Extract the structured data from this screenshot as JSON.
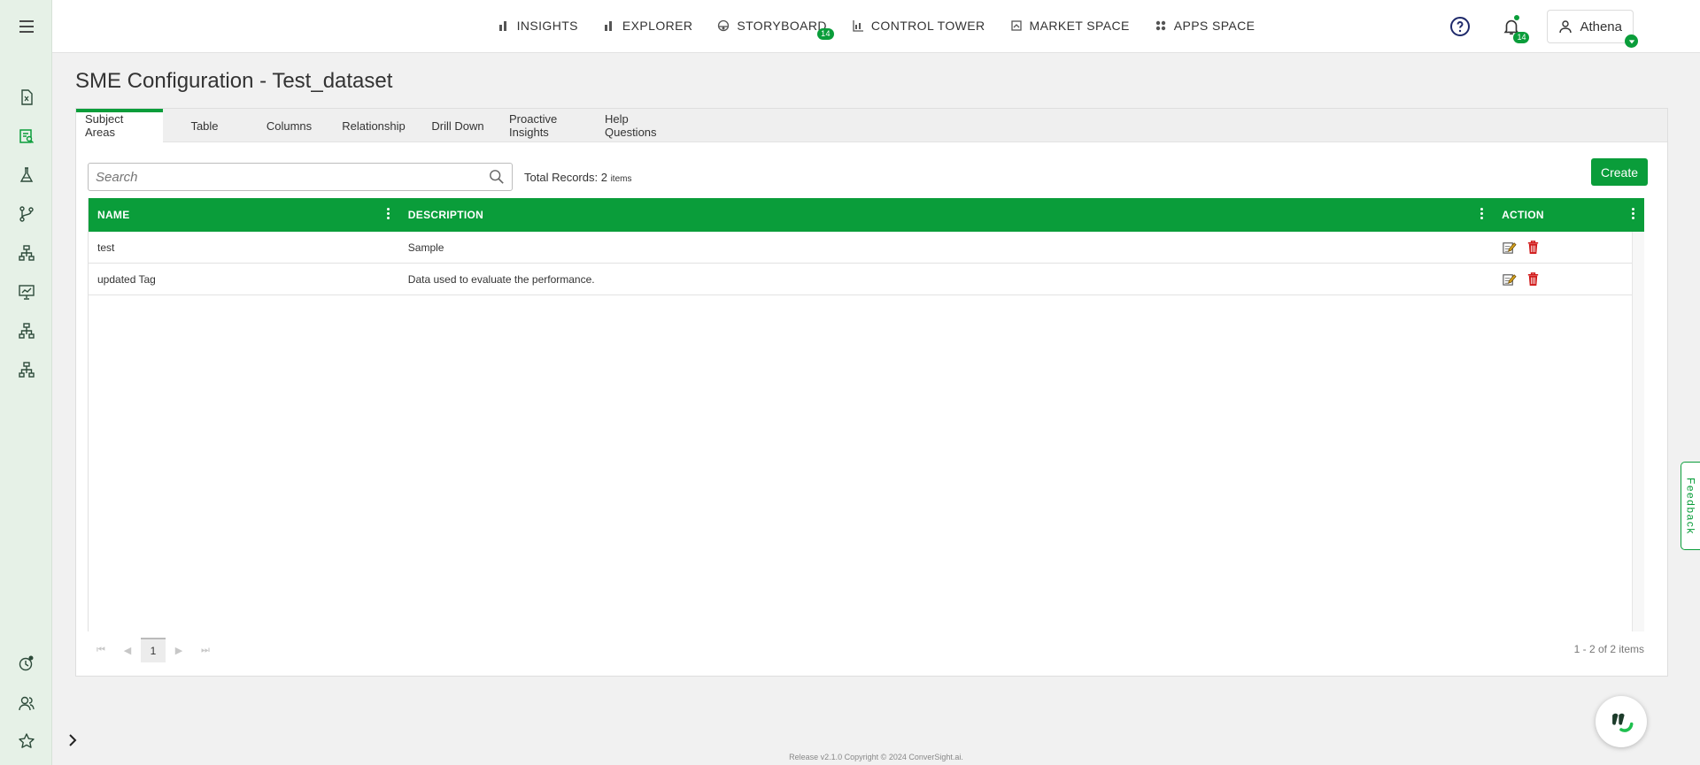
{
  "app": {
    "brand_color": "#0a9d3a"
  },
  "sidebar": {
    "items": [
      {
        "name": "menu-icon"
      },
      {
        "name": "formula-doc-icon"
      },
      {
        "name": "report-search-icon"
      },
      {
        "name": "flask-icon"
      },
      {
        "name": "git-branch-icon"
      },
      {
        "name": "hierarchy-icon"
      },
      {
        "name": "presentation-chart-icon"
      },
      {
        "name": "hierarchy-icon-2"
      },
      {
        "name": "hierarchy-icon-3"
      },
      {
        "name": "clock-alert-icon"
      },
      {
        "name": "users-icon"
      },
      {
        "name": "star-icon"
      }
    ]
  },
  "nav": {
    "items": [
      {
        "label": "INSIGHTS",
        "icon": "bar-chart-icon"
      },
      {
        "label": "EXPLORER",
        "icon": "bar-chart-icon"
      },
      {
        "label": "STORYBOARD",
        "icon": "palette-icon",
        "badge": "14"
      },
      {
        "label": "CONTROL TOWER",
        "icon": "tower-chart-icon"
      },
      {
        "label": "MARKET SPACE",
        "icon": "market-icon"
      },
      {
        "label": "APPS SPACE",
        "icon": "apps-grid-icon"
      }
    ]
  },
  "header": {
    "notification_count": "14",
    "user_name": "Athena"
  },
  "page": {
    "title": "SME Configuration - Test_dataset"
  },
  "tabs": [
    {
      "label": "Subject Areas",
      "active": true
    },
    {
      "label": "Table"
    },
    {
      "label": "Columns"
    },
    {
      "label": "Relationship"
    },
    {
      "label": "Drill Down"
    },
    {
      "label": "Proactive Insights"
    },
    {
      "label": "Help Questions"
    }
  ],
  "toolbar": {
    "search_placeholder": "Search",
    "total_label": "Total Records: 2",
    "total_unit": "items",
    "create_label": "Create"
  },
  "grid": {
    "columns": [
      "NAME",
      "DESCRIPTION",
      "ACTION"
    ],
    "rows": [
      {
        "name": "test",
        "description": "Sample"
      },
      {
        "name": "updated Tag",
        "description": "Data used to evaluate the performance."
      }
    ]
  },
  "pager": {
    "current_page": "1",
    "info": "1 - 2 of 2 items"
  },
  "feedback_label": "Feedback",
  "footer_text": "Release v2.1.0 Copyright © 2024 ConverSight.ai."
}
